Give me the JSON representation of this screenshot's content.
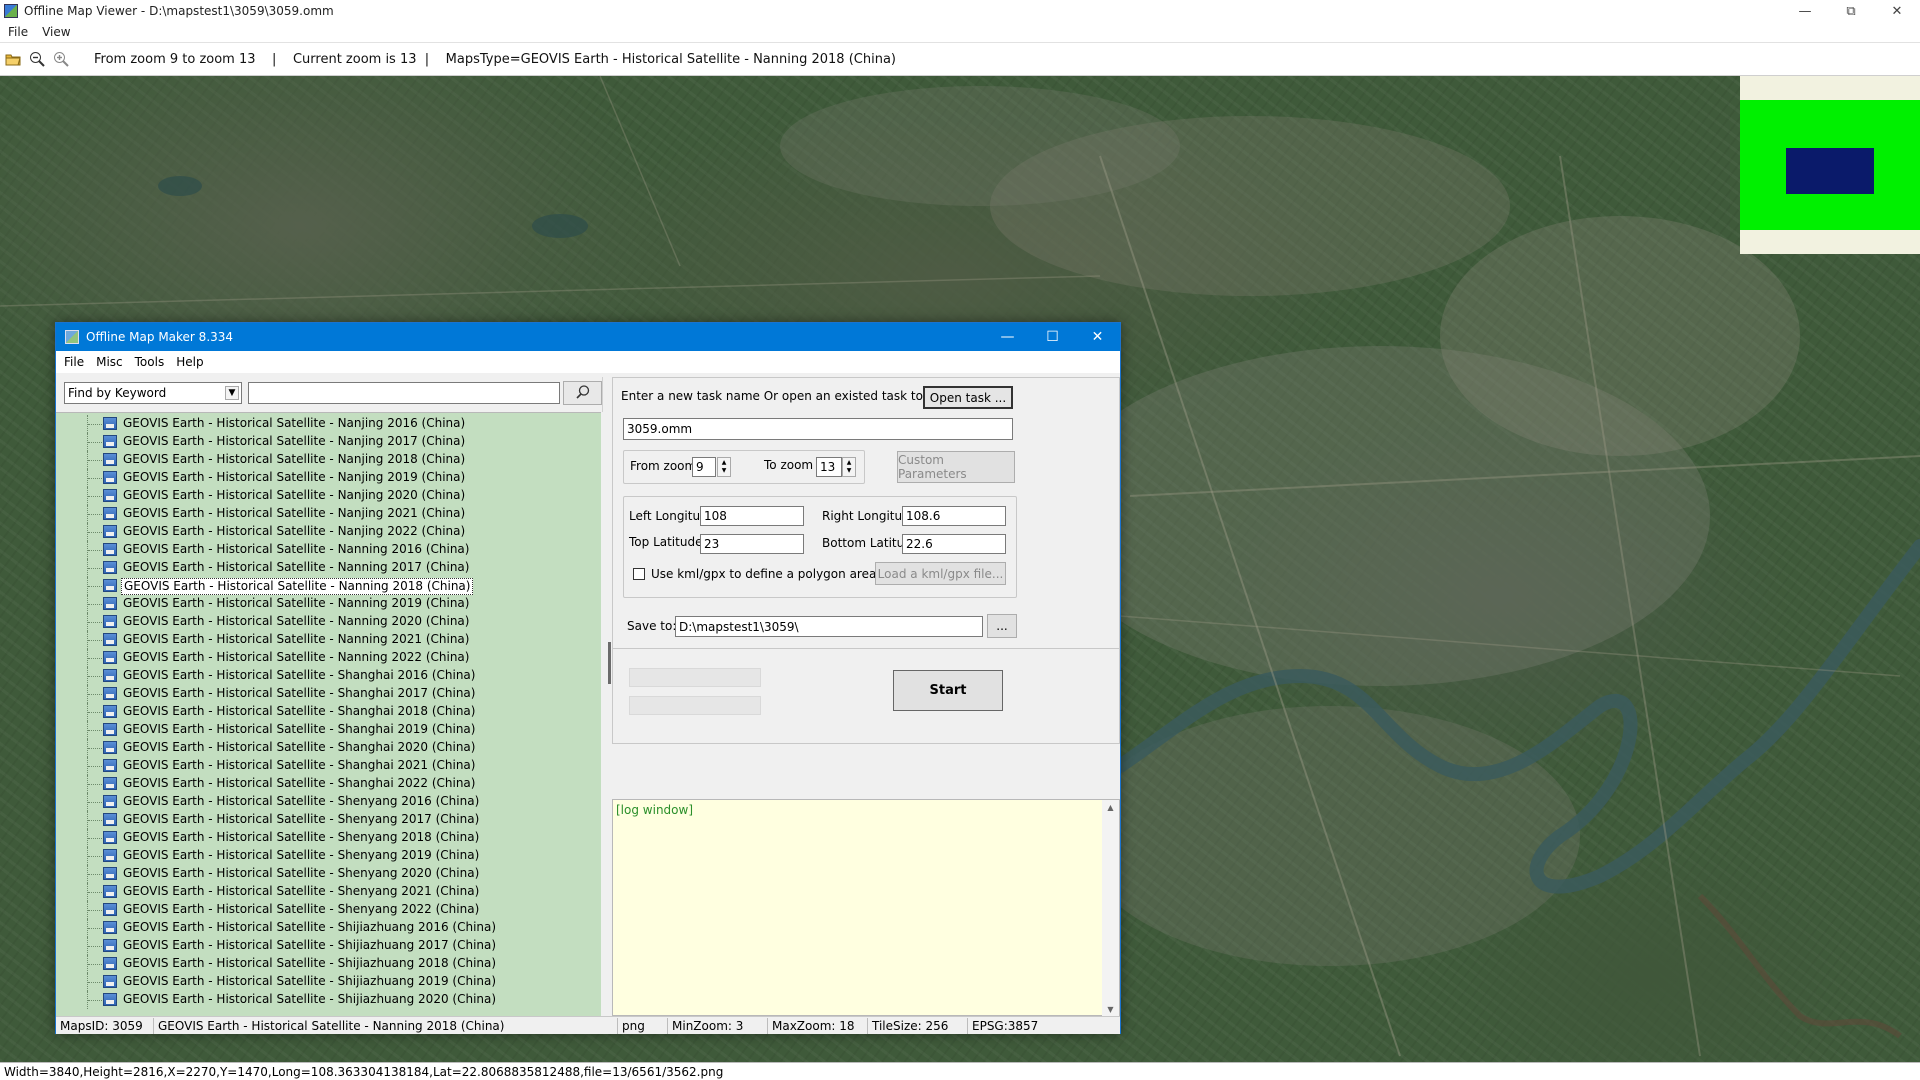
{
  "viewer": {
    "title": "Offline Map Viewer - D:\\mapstest1\\3059\\3059.omm",
    "menu": [
      "File",
      "View"
    ],
    "toolbar_text": "From zoom 9 to zoom 13    |    Current zoom is 13  |    MapsType=GEOVIS Earth - Historical Satellite - Nanning 2018 (China)",
    "status": "Width=3840,Height=2816,X=2270,Y=1470,Long=108.363304138184,Lat=22.8068835812488,file=13/6561/3562.png"
  },
  "maker": {
    "title": "Offline Map Maker 8.334",
    "menu": [
      "File",
      "Misc",
      "Tools",
      "Help"
    ],
    "finder": {
      "mode": "Find by Keyword",
      "keyword": ""
    },
    "tree_items": [
      "GEOVIS Earth - Historical Satellite - Nanjing 2016 (China)",
      "GEOVIS Earth - Historical Satellite - Nanjing 2017 (China)",
      "GEOVIS Earth - Historical Satellite - Nanjing 2018 (China)",
      "GEOVIS Earth - Historical Satellite - Nanjing 2019 (China)",
      "GEOVIS Earth - Historical Satellite - Nanjing 2020 (China)",
      "GEOVIS Earth - Historical Satellite - Nanjing 2021 (China)",
      "GEOVIS Earth - Historical Satellite - Nanjing 2022 (China)",
      "GEOVIS Earth - Historical Satellite - Nanning 2016 (China)",
      "GEOVIS Earth - Historical Satellite - Nanning 2017 (China)",
      "GEOVIS Earth - Historical Satellite - Nanning 2018 (China)",
      "GEOVIS Earth - Historical Satellite - Nanning 2019 (China)",
      "GEOVIS Earth - Historical Satellite - Nanning 2020 (China)",
      "GEOVIS Earth - Historical Satellite - Nanning 2021 (China)",
      "GEOVIS Earth - Historical Satellite - Nanning 2022 (China)",
      "GEOVIS Earth - Historical Satellite - Shanghai 2016 (China)",
      "GEOVIS Earth - Historical Satellite - Shanghai 2017 (China)",
      "GEOVIS Earth - Historical Satellite - Shanghai 2018 (China)",
      "GEOVIS Earth - Historical Satellite - Shanghai 2019 (China)",
      "GEOVIS Earth - Historical Satellite - Shanghai 2020 (China)",
      "GEOVIS Earth - Historical Satellite - Shanghai 2021 (China)",
      "GEOVIS Earth - Historical Satellite - Shanghai 2022 (China)",
      "GEOVIS Earth - Historical Satellite - Shenyang 2016 (China)",
      "GEOVIS Earth - Historical Satellite - Shenyang 2017 (China)",
      "GEOVIS Earth - Historical Satellite - Shenyang 2018 (China)",
      "GEOVIS Earth - Historical Satellite - Shenyang 2019 (China)",
      "GEOVIS Earth - Historical Satellite - Shenyang 2020 (China)",
      "GEOVIS Earth - Historical Satellite - Shenyang 2021 (China)",
      "GEOVIS Earth - Historical Satellite - Shenyang 2022 (China)",
      "GEOVIS Earth - Historical Satellite - Shijiazhuang 2016 (China)",
      "GEOVIS Earth - Historical Satellite - Shijiazhuang 2017 (China)",
      "GEOVIS Earth - Historical Satellite - Shijiazhuang 2018 (China)",
      "GEOVIS Earth - Historical Satellite - Shijiazhuang 2019 (China)",
      "GEOVIS Earth - Historical Satellite - Shijiazhuang 2020 (China)"
    ],
    "selected_item": "GEOVIS Earth - Historical Satellite - Nanning 2018 (China)",
    "task": {
      "prompt": "Enter a new task name Or open an existed task to continue:",
      "open_button": "Open task ...",
      "name": "3059.omm"
    },
    "zoom": {
      "from_label": "From zoom",
      "from_value": "9",
      "to_label": "To zoom",
      "to_value": "13",
      "custom_button": "Custom Parameters"
    },
    "bounds": {
      "left_label": "Left Longitude",
      "left_value": "108",
      "right_label": "Right Longitude",
      "right_value": "108.6",
      "top_label": "Top Latitude",
      "top_value": "23",
      "bottom_label": "Bottom Latitude",
      "bottom_value": "22.6",
      "kml_label": "Use kml/gpx to define a polygon area",
      "kml_checked": false,
      "kml_button": "Load a kml/gpx file..."
    },
    "save": {
      "label": "Save to:",
      "path": "D:\\mapstest1\\3059\\",
      "browse": "..."
    },
    "start_button": "Start",
    "log_text": "[log window]",
    "status": {
      "maps_id": "MapsID: 3059",
      "maps_name": "GEOVIS Earth - Historical Satellite - Nanning 2018 (China)",
      "format": "png",
      "min_zoom": "MinZoom: 3",
      "max_zoom": "MaxZoom: 18",
      "tile_size": "TileSize: 256",
      "epsg": "EPSG:3857"
    }
  },
  "colors": {
    "titlebar": "#0078d7",
    "tree_bg": "#c3dec0",
    "log_bg": "#ffffe0",
    "log_text": "#2a8f2a",
    "minimap_green": "#00f000",
    "minimap_view": "#0a1a6a"
  }
}
